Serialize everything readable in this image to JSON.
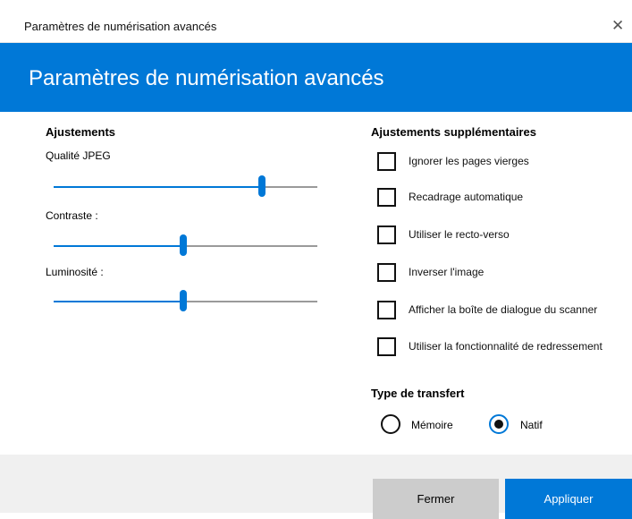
{
  "window": {
    "title": "Paramètres de numérisation avancés",
    "close_glyph": "✕"
  },
  "banner": {
    "heading": "Paramètres de numérisation avancés"
  },
  "adjustments": {
    "title": "Ajustements",
    "sliders": [
      {
        "label": "Qualité JPEG",
        "value_fraction": 0.79
      },
      {
        "label": "Contraste :",
        "value_fraction": 0.49
      },
      {
        "label": "Luminosité :",
        "value_fraction": 0.49
      }
    ]
  },
  "extra": {
    "title": "Ajustements supplémentaires",
    "checkboxes": [
      {
        "label": "Ignorer les pages vierges",
        "checked": false
      },
      {
        "label": "Recadrage automatique",
        "checked": false
      },
      {
        "label": "Utiliser le recto-verso",
        "checked": false
      },
      {
        "label": "Inverser l'image",
        "checked": false
      },
      {
        "label": "Afficher la boîte de dialogue du scanner",
        "checked": false
      },
      {
        "label": "Utiliser la fonctionnalité de redressement",
        "checked": false
      }
    ]
  },
  "transfer": {
    "title": "Type de transfert",
    "options": [
      {
        "label": "Mémoire",
        "selected": false
      },
      {
        "label": "Natif",
        "selected": true
      }
    ]
  },
  "buttons": {
    "close": "Fermer",
    "apply": "Appliquer"
  },
  "colors": {
    "accent": "#0078d7",
    "footer": "#f0f0f0",
    "secondary_button": "#cccccc"
  }
}
